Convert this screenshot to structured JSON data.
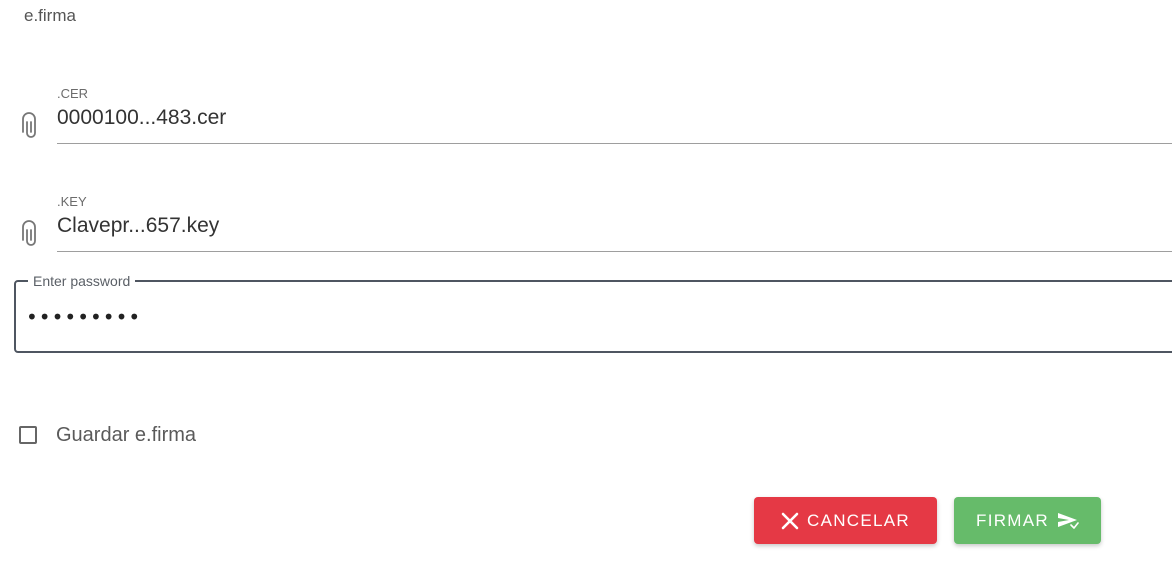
{
  "section": {
    "title": "e.firma"
  },
  "cer_field": {
    "label": ".CER",
    "value": "0000100...483.cer",
    "icon": "paperclip-icon"
  },
  "key_field": {
    "label": ".KEY",
    "value": "Clavepr...657.key",
    "icon": "paperclip-icon"
  },
  "password_field": {
    "label": "Enter password",
    "value": "•••••••••"
  },
  "save_checkbox": {
    "label": "Guardar e.firma",
    "checked": false
  },
  "buttons": {
    "cancel_label": "CANCELAR",
    "cancel_icon": "close-icon",
    "cancel_color": "#e53945",
    "sign_label": "FIRMAR",
    "sign_icon": "send-icon",
    "sign_color": "#66bb6a"
  }
}
